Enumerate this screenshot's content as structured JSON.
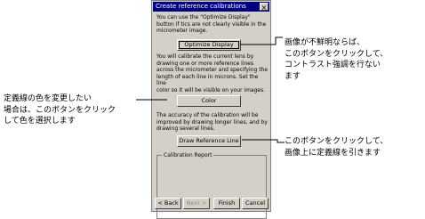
{
  "dialog": {
    "title": "Create reference calibrations",
    "close_glyph": "×",
    "text_optimize": "You can use the \"Optimize Display\"\nbutton if tics are not clearly visible in the\nmicrometer image.",
    "optimize_button": "Optimize Display",
    "text_calibrate": "You will calibrate the current lens by\ndrawing one or more reference lines\nacross the micrometer and specifying the\nlength of each line in microns. Set the line\ncolor so it will be visible on your images.",
    "color_button": "Color",
    "text_accuracy": "The accuracy of the calibration will be\nimproved by drawing longer lines, and by\ndrawing several lines.",
    "draw_button": "Draw Reference Line",
    "report_group": "Calibration Report",
    "nav": {
      "back": "< Back",
      "next": "Next >",
      "finish": "Finish",
      "cancel": "Cancel"
    }
  },
  "annotations": {
    "optimize": "画像が不鮮明ならば、\nこのボタンをクリックして、\nコントラスト強調を行ない\nます",
    "color": "定義線の色を変更したい\n場合は、このボタンをクリック\nして色を選択します",
    "draw": "このボタンをクリックして、\n画像上に定義線を引きます"
  }
}
